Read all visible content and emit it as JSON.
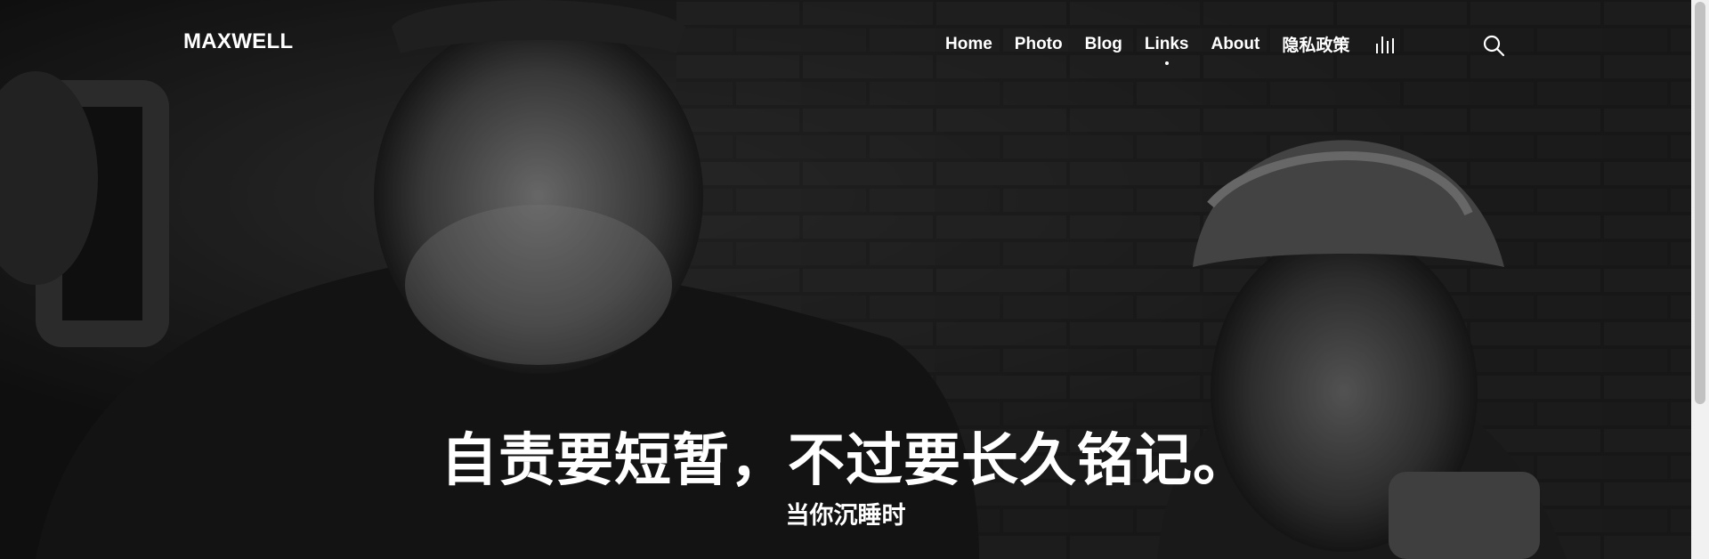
{
  "header": {
    "logo": "MAXWELL",
    "nav": [
      {
        "label": "Home",
        "active": false
      },
      {
        "label": "Photo",
        "active": false
      },
      {
        "label": "Blog",
        "active": false
      },
      {
        "label": "Links",
        "active": true
      },
      {
        "label": "About",
        "active": false
      },
      {
        "label": "隐私政策",
        "active": false
      }
    ],
    "icons": {
      "menu": "bars-icon",
      "search": "search-icon"
    }
  },
  "hero": {
    "title": "自责要短暂，不过要长久铭记。",
    "subtitle": "当你沉睡时"
  },
  "colors": {
    "text": "#ffffff",
    "overlay": "#000000"
  }
}
